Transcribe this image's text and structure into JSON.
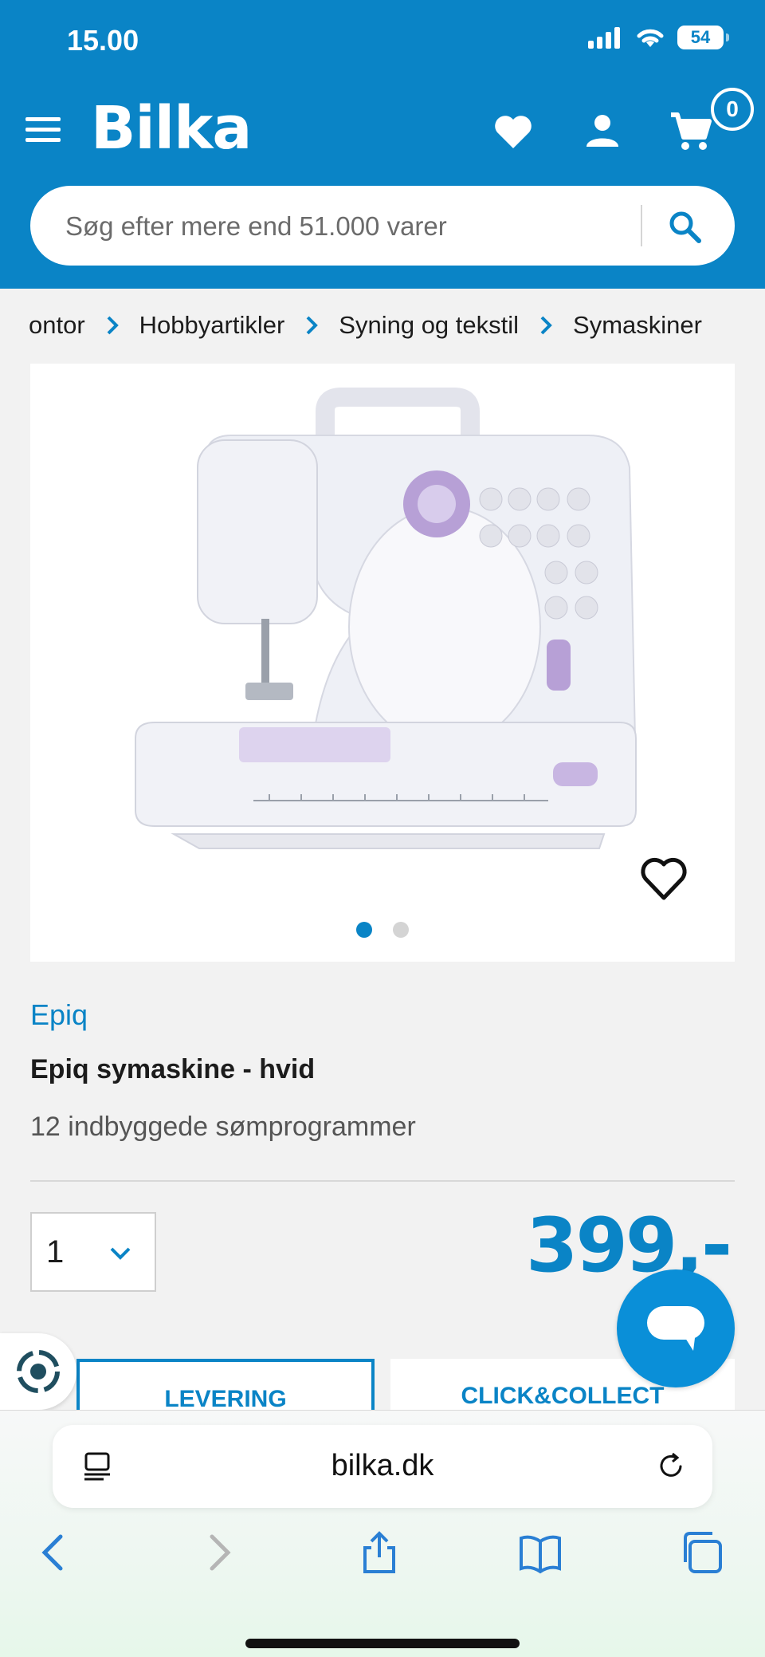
{
  "status_bar": {
    "time": "15.00",
    "battery": "54"
  },
  "header": {
    "logo": "Bilka",
    "cart_count": "0",
    "search_placeholder": "Søg efter mere end 51.000 varer"
  },
  "breadcrumb": [
    "ontor",
    "Hobbyartikler",
    "Syning og tekstil",
    "Symaskiner"
  ],
  "gallery": {
    "image_count": 2,
    "active_index": 0
  },
  "product": {
    "brand": "Epiq",
    "title": "Epiq symaskine - hvid",
    "subtitle": "12 indbyggede sømprogrammer",
    "quantity": "1",
    "price": "399,-"
  },
  "delivery_tabs": [
    "LEVERING",
    "CLICK&COLLECT"
  ],
  "browser": {
    "url": "bilka.dk"
  },
  "colors": {
    "brand_blue": "#0a84c6",
    "lilac": "#b7a0d6"
  },
  "icons": [
    "menu-icon",
    "heart-icon",
    "user-icon",
    "cart-icon",
    "search-icon",
    "chevron-right-icon",
    "chevron-down-icon",
    "chat-icon",
    "reader-icon",
    "reload-icon",
    "back-icon",
    "forward-icon",
    "share-icon",
    "bookmarks-icon",
    "tabs-icon"
  ]
}
